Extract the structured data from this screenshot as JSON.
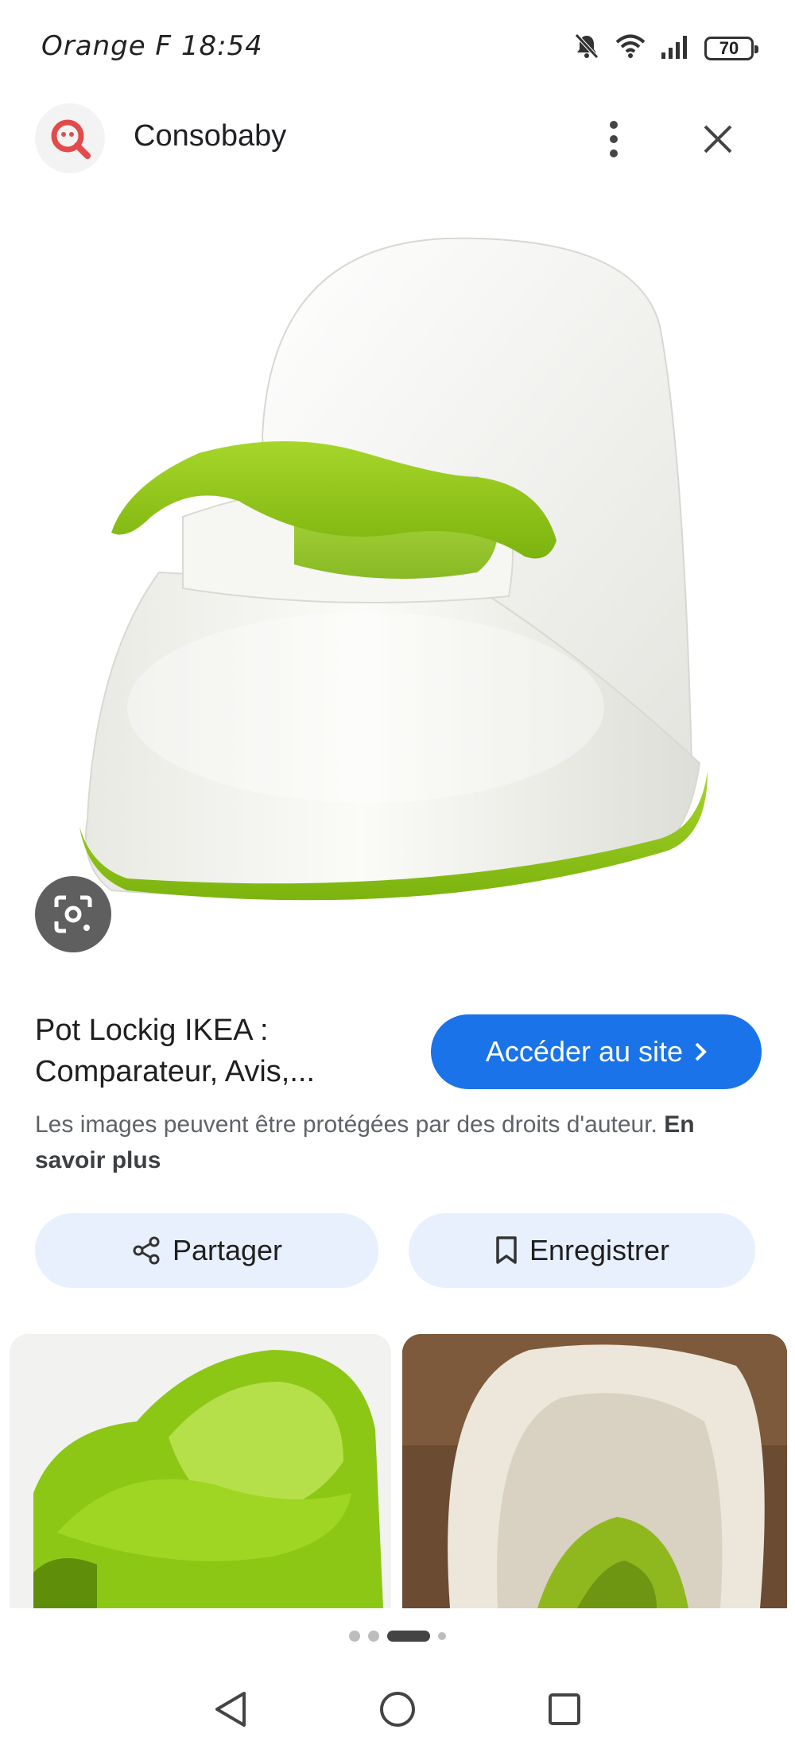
{
  "status_bar": {
    "carrier": "Orange F",
    "time": "18:54",
    "battery": "70"
  },
  "header": {
    "site_name": "Consobaby"
  },
  "result": {
    "title_line1": "Pot Lockig IKEA :",
    "title_line2": "Comparateur, Avis,...",
    "visit_label": "Accéder au site"
  },
  "copyright": {
    "text": "Les images peuvent être protégées par des droits d'auteur.",
    "link": "En savoir plus"
  },
  "actions": {
    "share_label": "Partager",
    "save_label": "Enregistrer"
  },
  "pager": {
    "count": 4,
    "active_index": 2
  },
  "colors": {
    "accent": "#1a73e8",
    "pill_bg": "#e8f0fe",
    "potty_green": "#8cc716"
  }
}
